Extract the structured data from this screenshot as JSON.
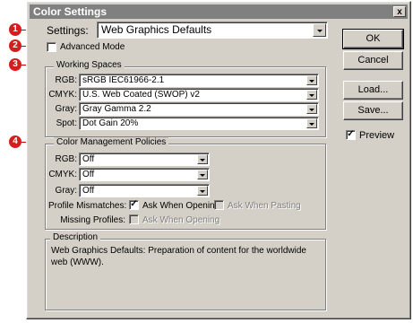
{
  "window": {
    "title": "Color Settings",
    "close_label": "x"
  },
  "annotations": [
    "1",
    "2",
    "3",
    "4"
  ],
  "settings": {
    "label": "Settings:",
    "value": "Web Graphics Defaults"
  },
  "advanced_mode": {
    "label": "Advanced Mode",
    "checked": false
  },
  "working_spaces": {
    "title": "Working Spaces",
    "rows": [
      {
        "label": "RGB:",
        "value": "sRGB IEC61966-2.1"
      },
      {
        "label": "CMYK:",
        "value": "U.S. Web Coated (SWOP) v2"
      },
      {
        "label": "Gray:",
        "value": "Gray Gamma 2.2"
      },
      {
        "label": "Spot:",
        "value": "Dot Gain 20%"
      }
    ]
  },
  "policies": {
    "title": "Color Management Policies",
    "rows": [
      {
        "label": "RGB:",
        "value": "Off"
      },
      {
        "label": "CMYK:",
        "value": "Off"
      },
      {
        "label": "Gray:",
        "value": "Off"
      }
    ],
    "profile_mismatches_label": "Profile Mismatches:",
    "ask_when_opening_label": "Ask When Opening",
    "ask_when_opening_checked": true,
    "ask_when_pasting_label": "Ask When Pasting",
    "missing_profiles_label": "Missing Profiles:",
    "missing_ask_when_opening_label": "Ask When Opening"
  },
  "description": {
    "title": "Description",
    "text": "Web Graphics Defaults:  Preparation of content for the worldwide web (WWW)."
  },
  "buttons": {
    "ok": "OK",
    "cancel": "Cancel",
    "load": "Load...",
    "save": "Save..."
  },
  "preview": {
    "label": "Preview",
    "checked": true
  }
}
